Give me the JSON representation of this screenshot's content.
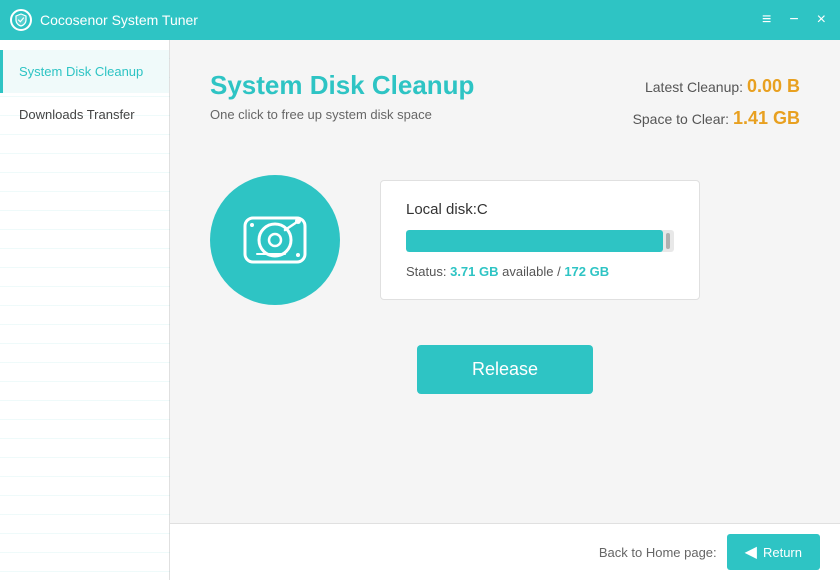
{
  "titlebar": {
    "title": "Cocosenor System Tuner",
    "icon_label": "shield-icon",
    "btn_menu": "≡",
    "btn_minimize": "−",
    "btn_close": "×"
  },
  "sidebar": {
    "items": [
      {
        "id": "system-disk-cleanup",
        "label": "System Disk Cleanup",
        "active": true
      },
      {
        "id": "downloads-transfer",
        "label": "Downloads Transfer",
        "active": false
      }
    ]
  },
  "content": {
    "title": "System Disk Cleanup",
    "subtitle": "One click to free up system disk space",
    "stats": {
      "latest_cleanup_label": "Latest Cleanup:",
      "latest_cleanup_value": "0.00 B",
      "space_to_clear_label": "Space to Clear:",
      "space_to_clear_value": "1.41 GB"
    },
    "disk": {
      "label": "Local disk:C",
      "bar_fill_percent": 96,
      "status_label": "Status:",
      "available": "3.71 GB",
      "separator": "available /",
      "total": "172 GB"
    },
    "release_button": "Release"
  },
  "bottom": {
    "back_label": "Back to Home page:",
    "return_button": "Return"
  }
}
